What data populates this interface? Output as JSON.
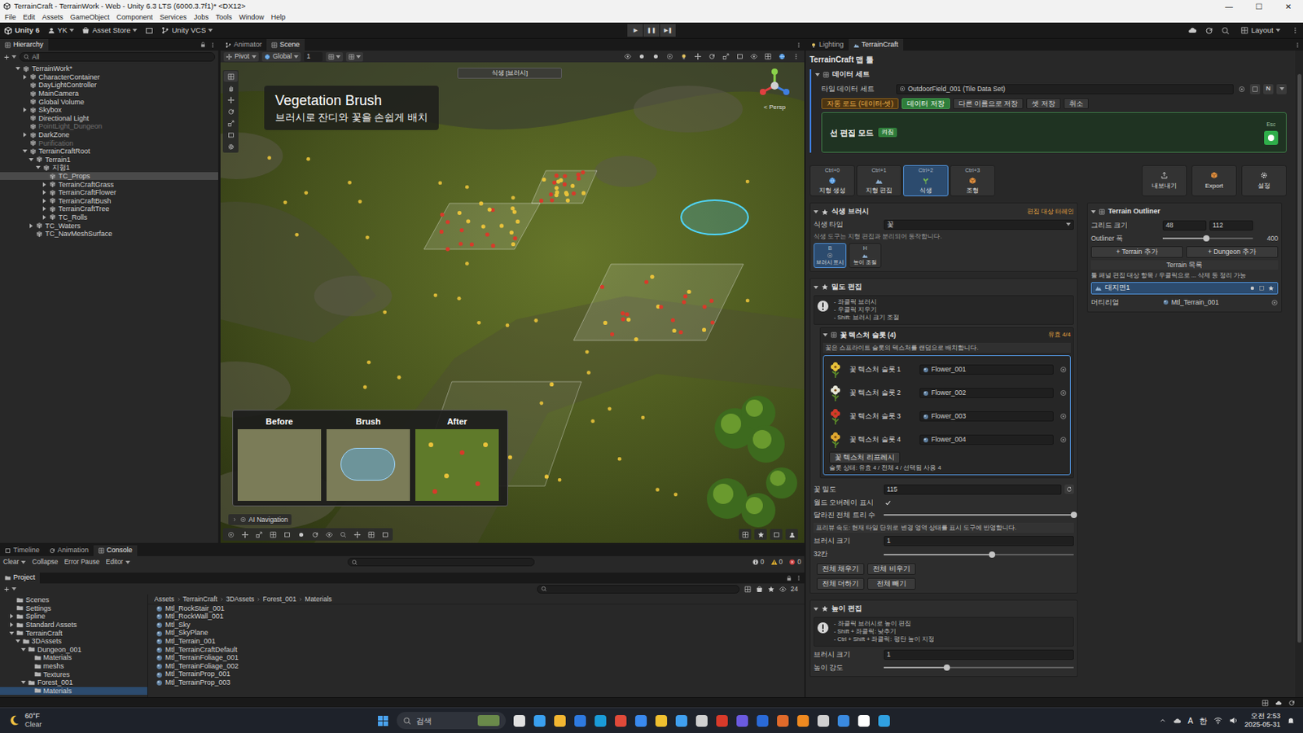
{
  "window": {
    "title": "TerrainCraft - TerrainWork - Web - Unity 6.3 LTS (6000.3.7f1)* <DX12>",
    "controls": [
      "—",
      "☐",
      "✕"
    ]
  },
  "menu": [
    "File",
    "Edit",
    "Assets",
    "GameObject",
    "Component",
    "Services",
    "Jobs",
    "Tools",
    "Window",
    "Help"
  ],
  "toolbar": {
    "account": "Unity 6",
    "user": "YK",
    "store": "Asset Store",
    "vcs": "Unity VCS",
    "play": [
      "▶",
      "❚❚",
      "▶❚"
    ],
    "layout": "Layout"
  },
  "hierarchy": {
    "title": "Hierarchy",
    "search": "All",
    "items": [
      {
        "label": "TerrainWork*",
        "kind": "group",
        "expanded": true,
        "selected": false,
        "disabled": false,
        "children": [
          {
            "label": "CharacterContainer",
            "kind": "group",
            "expanded": false,
            "selected": false,
            "disabled": false,
            "children": []
          },
          {
            "label": "DayLightController",
            "kind": "object",
            "selected": false,
            "disabled": false
          },
          {
            "label": "MainCamera",
            "kind": "object",
            "selected": false,
            "disabled": false
          },
          {
            "label": "Global Volume",
            "kind": "object",
            "selected": false,
            "disabled": false
          },
          {
            "label": "Skybox",
            "kind": "group",
            "expanded": false,
            "selected": false,
            "disabled": false,
            "children": []
          },
          {
            "label": "Directional Light",
            "kind": "object",
            "selected": false,
            "disabled": false
          },
          {
            "label": "PointLight_Dungeon",
            "kind": "object",
            "selected": false,
            "disabled": true
          },
          {
            "label": "DarkZone",
            "kind": "group",
            "expanded": false,
            "selected": false,
            "disabled": false,
            "children": []
          },
          {
            "label": "Purification",
            "kind": "object",
            "selected": false,
            "disabled": true
          },
          {
            "label": "TerrainCraftRoot",
            "kind": "group",
            "expanded": true,
            "selected": false,
            "disabled": false,
            "children": [
              {
                "label": "Terrain1",
                "kind": "group",
                "expanded": true,
                "selected": false,
                "disabled": false,
                "children": [
                  {
                    "label": "지형1",
                    "kind": "group",
                    "expanded": true,
                    "selected": false,
                    "disabled": false,
                    "children": [
                      {
                        "label": "TC_Props",
                        "kind": "object",
                        "selected": true,
                        "disabled": false
                      },
                      {
                        "label": "TerrainCraftGrass",
                        "kind": "group",
                        "expanded": false,
                        "selected": false,
                        "disabled": false,
                        "children": []
                      },
                      {
                        "label": "TerrainCraftFlower",
                        "kind": "group",
                        "expanded": false,
                        "selected": false,
                        "disabled": false,
                        "children": []
                      },
                      {
                        "label": "TerrainCraftBush",
                        "kind": "group",
                        "expanded": false,
                        "selected": false,
                        "disabled": false,
                        "children": []
                      },
                      {
                        "label": "TerrainCraftTree",
                        "kind": "group",
                        "expanded": false,
                        "selected": false,
                        "disabled": false,
                        "children": []
                      },
                      {
                        "label": "TC_Rolls",
                        "kind": "group",
                        "expanded": false,
                        "selected": false,
                        "disabled": false,
                        "children": []
                      }
                    ]
                  }
                ]
              },
              {
                "label": "TC_Waters",
                "kind": "group",
                "expanded": false,
                "selected": false,
                "disabled": false,
                "children": []
              },
              {
                "label": "TC_NavMeshSurface",
                "kind": "object",
                "selected": false,
                "disabled": false
              }
            ]
          }
        ]
      }
    ]
  },
  "scene": {
    "tabs": [
      {
        "label": "Animator",
        "selected": false
      },
      {
        "label": "Scene",
        "selected": true
      }
    ],
    "pivot": "Pivot",
    "space": "Global",
    "grid_step": "1",
    "top_label": "식생 [브러시]",
    "overlay": {
      "title": "Vegetation Brush",
      "subtitle": "브러시로 잔디와 꽃을 손쉽게 배치"
    },
    "gizmo": "< Persp",
    "compare": [
      "Before",
      "Brush",
      "After"
    ],
    "ai_navigation": "AI Navigation"
  },
  "terraincraft": {
    "tabs": [
      {
        "label": "Lighting",
        "selected": false
      },
      {
        "label": "TerrainCraft",
        "selected": true
      }
    ],
    "title": "TerrainCraft 맵 툴",
    "dataset": {
      "expanded": true,
      "header": "데이터 세트",
      "label": "타일 데이터 세트",
      "value": "OutdoorField_001 (Tile Data Set)",
      "tag": "N",
      "buttons": [
        {
          "label": "자동 로드 (데이터-셋)",
          "kind": "warning"
        },
        {
          "label": "데이터 저장",
          "kind": "primary"
        },
        {
          "label": "다른 이름으로 저장",
          "kind": "normal"
        },
        {
          "label": "셋 저장",
          "kind": "normal"
        },
        {
          "label": "취소",
          "kind": "normal"
        }
      ]
    },
    "edit_mode": {
      "label": "선 편집 모드",
      "badge": "켜짐",
      "shortcut": "Esc",
      "on": true
    },
    "modes": [
      {
        "shortcut": "Ctrl+0",
        "label": "지형 생성",
        "selected": false
      },
      {
        "shortcut": "Ctrl+1",
        "label": "지형 편집",
        "selected": false
      },
      {
        "shortcut": "Ctrl+2",
        "label": "식생",
        "selected": true
      },
      {
        "shortcut": "Ctrl+3",
        "label": "조형",
        "selected": false
      }
    ],
    "actions": [
      "내보내기",
      "Export",
      "설정"
    ],
    "vegetation": {
      "expanded": true,
      "header": "식생 브러시",
      "status": "편집 대상 터레인",
      "type_label": "식생 타입",
      "type_value": "꽃",
      "note": "식생 도구는 지형 편집과 분리되어 동작합니다.",
      "tools": [
        {
          "key": "B",
          "label": "브러시 표시",
          "selected": true
        },
        {
          "key": "H",
          "label": "높이 조절",
          "selected": false
        }
      ]
    },
    "density": {
      "expanded": true,
      "header": "밀도 편집",
      "warning": [
        "- 좌클릭 브러시",
        "- 우클릭 지우기",
        "- Shift: 브러시 크기 조절"
      ],
      "slots_expanded": true,
      "slots_header": "꽃 텍스처 슬롯 (4)",
      "slots_status": "유효 4/4",
      "slots_note": "꽃은 스프라이트 슬롯의 텍스처를 랜덤으로 배치합니다.",
      "slots": [
        {
          "label": "꽃 텍스처 슬롯 1",
          "texture": "Flower_001",
          "color": "#e8c23a"
        },
        {
          "label": "꽃 텍스처 슬롯 2",
          "texture": "Flower_002",
          "color": "#e6e6d8"
        },
        {
          "label": "꽃 텍스처 슬롯 3",
          "texture": "Flower_003",
          "color": "#d43a2a"
        },
        {
          "label": "꽃 텍스처 슬롯 4",
          "texture": "Flower_004",
          "color": "#e0a830"
        }
      ],
      "refresh": "꽃 텍스처 리프레시",
      "slot_summary": "슬롯 상태: 유효 4 / 전체 4 / 선택됨 사용 4",
      "density_label": "꽃 밀도",
      "density_value": "115",
      "overlay_label": "월드 오버레이 표시",
      "overlay_checked": true,
      "tree_label": "달라진 전체 트리 수",
      "tree_level": 1.0,
      "tree_note": "프리뷰 속도: 현재 타일 단위로 변경 영역 상태를 표시 도구에 반영합니다.",
      "brush_label": "브러시 크기",
      "brush_value": "1",
      "brush_cells": "32칸",
      "brush_level": 0.57,
      "buttons": [
        "전체 채우기",
        "전체 비우기",
        "전체 더하기",
        "전체 빼기"
      ]
    },
    "height": {
      "expanded": true,
      "header": "높이 편집",
      "warning": [
        "- 좌클릭 브러시로 높이 편집",
        "- Shift + 좌클릭: 낮추기",
        "- Ctrl + Shift + 좌클릭: 평탄 높이 지정"
      ],
      "brush_label": "브러시 크기",
      "brush_value": "1",
      "strength_label": "높이 강도",
      "strength_level": 0.33
    },
    "outliner": {
      "expanded": true,
      "header": "Terrain Outliner",
      "grid_label": "그리드 크기",
      "grid_x": "48",
      "grid_y": "112",
      "width_label": "Outliner 폭",
      "width_value": "400",
      "width_level": 0.48,
      "add_terrain": "+ Terrain 추가",
      "add_dungeon": "+ Dungeon 추가",
      "list_label": "Terrain 목록",
      "hint": "툴 패널 편집 대상 항목 / 우클릭으로 ... 삭제 등 정리 가능",
      "items": [
        {
          "label": "대지면1",
          "selected": true
        }
      ],
      "material_label": "머티리얼",
      "material_value": "Mtl_Terrain_001"
    }
  },
  "console": {
    "tabs": [
      {
        "label": "Timeline",
        "selected": false
      },
      {
        "label": "Animation",
        "selected": false
      },
      {
        "label": "Console",
        "selected": true
      }
    ],
    "toolbar": [
      "Clear",
      "Collapse",
      "Error Pause",
      "Editor"
    ],
    "counts": [
      "0",
      "0",
      "0"
    ]
  },
  "project": {
    "title": "Project",
    "count": "24",
    "tree": [
      {
        "label": "Scenes",
        "kind": "object",
        "selected": false
      },
      {
        "label": "Settings",
        "kind": "object",
        "selected": false
      },
      {
        "label": "Spline",
        "kind": "group",
        "expanded": false,
        "selected": false,
        "children": []
      },
      {
        "label": "Standard Assets",
        "kind": "group",
        "expanded": false,
        "selected": false,
        "children": []
      },
      {
        "label": "TerrainCraft",
        "kind": "group",
        "expanded": true,
        "selected": false,
        "children": [
          {
            "label": "3DAssets",
            "kind": "group",
            "expanded": true,
            "selected": false,
            "children": [
              {
                "label": "Dungeon_001",
                "kind": "group",
                "expanded": true,
                "selected": false,
                "children": [
                  {
                    "label": "Materials",
                    "kind": "object",
                    "selected": false
                  },
                  {
                    "label": "meshs",
                    "kind": "object",
                    "selected": false
                  },
                  {
                    "label": "Textures",
                    "kind": "object",
                    "selected": false
                  }
                ]
              },
              {
                "label": "Forest_001",
                "kind": "group",
                "expanded": true,
                "selected": false,
                "children": [
                  {
                    "label": "Materials",
                    "kind": "object",
                    "selected": true
                  }
                ]
              }
            ]
          }
        ]
      }
    ],
    "breadcrumb": [
      "Assets",
      "TerrainCraft",
      "3DAssets",
      "Forest_001",
      "Materials"
    ],
    "files": [
      "Mtl_RockStair_001",
      "Mtl_RockWall_001",
      "Mtl_Sky",
      "Mtl_SkyPlane",
      "Mtl_Terrain_001",
      "Mtl_TerrainCraftDefault",
      "Mtl_TerrainFoliage_001",
      "Mtl_TerrainFoliage_002",
      "Mtl_TerrainProp_001",
      "Mtl_TerrainProp_003"
    ]
  },
  "taskbar": {
    "temperature": "60°F",
    "weather": "Clear",
    "search": "검색",
    "tray": [
      "A",
      "한"
    ],
    "time": "오전 2:53",
    "date": "2025-05-31"
  }
}
